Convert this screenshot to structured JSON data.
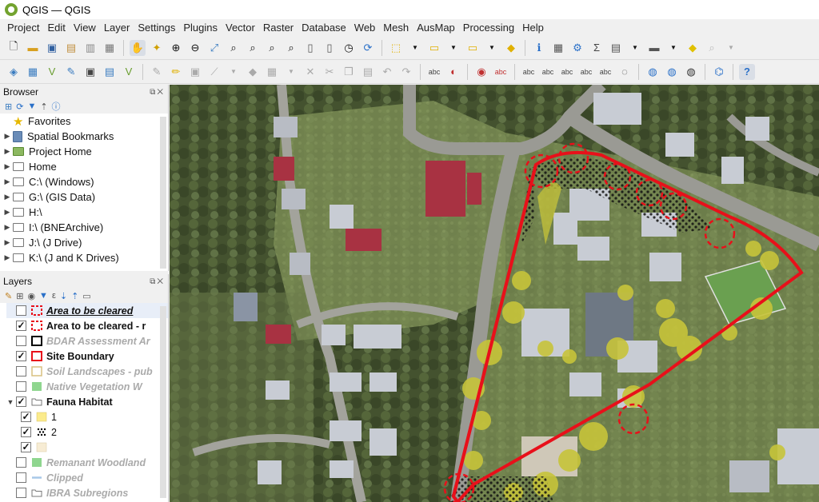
{
  "window": {
    "title": "QGIS — QGIS"
  },
  "menu": [
    "Project",
    "Edit",
    "View",
    "Layer",
    "Settings",
    "Plugins",
    "Vector",
    "Raster",
    "Database",
    "Web",
    "Mesh",
    "AusMap",
    "Processing",
    "Help"
  ],
  "browser": {
    "title": "Browser",
    "items": [
      {
        "label": "Favorites",
        "icon": "star-icon",
        "expand": false
      },
      {
        "label": "Spatial Bookmarks",
        "icon": "bookmark-icon",
        "expand": true
      },
      {
        "label": "Project Home",
        "icon": "project-home-icon",
        "expand": true
      },
      {
        "label": "Home",
        "icon": "home-icon",
        "expand": true
      },
      {
        "label": "C:\\ (Windows)",
        "icon": "folder-icon",
        "expand": true
      },
      {
        "label": "G:\\ (GIS Data)",
        "icon": "folder-icon",
        "expand": true
      },
      {
        "label": "H:\\",
        "icon": "folder-icon",
        "expand": true
      },
      {
        "label": "I:\\ (BNEArchive)",
        "icon": "folder-icon",
        "expand": true
      },
      {
        "label": "J:\\ (J Drive)",
        "icon": "folder-icon",
        "expand": true
      },
      {
        "label": "K:\\ (J and K Drives)",
        "icon": "folder-icon",
        "expand": true
      }
    ]
  },
  "layers": {
    "title": "Layers",
    "items": [
      {
        "label": "Area to be cleared",
        "checked": false,
        "style": "bold-italic-underline",
        "symbol": "dash-red",
        "indent": 0,
        "selected": true
      },
      {
        "label": "Area to be cleared - r",
        "checked": true,
        "style": "bold",
        "symbol": "dash-red",
        "indent": 0
      },
      {
        "label": "BDAR Assessment Ar",
        "checked": false,
        "style": "italic-grey",
        "symbol": "black-outline",
        "indent": 0
      },
      {
        "label": "Site Boundary",
        "checked": true,
        "style": "bold",
        "symbol": "red-outline",
        "indent": 0
      },
      {
        "label": "Soil Landscapes - pub",
        "checked": false,
        "style": "italic-grey",
        "symbol": "tan-outline",
        "indent": 0
      },
      {
        "label": "Native Vegetation W",
        "checked": false,
        "style": "italic-grey",
        "symbol": "green-fill",
        "indent": 0
      },
      {
        "label": "Fauna Habitat",
        "checked": true,
        "style": "bold",
        "symbol": "group",
        "indent": 0,
        "expand": true
      },
      {
        "label": "1",
        "checked": true,
        "style": "normal",
        "symbol": "yellow-fill",
        "indent": 1
      },
      {
        "label": "2",
        "checked": true,
        "style": "normal",
        "symbol": "dots",
        "indent": 1
      },
      {
        "label": "",
        "checked": true,
        "style": "normal",
        "symbol": "beige-fill",
        "indent": 1
      },
      {
        "label": "Remanant Woodland",
        "checked": false,
        "style": "italic-grey",
        "symbol": "green-fill",
        "indent": 0
      },
      {
        "label": "Clipped",
        "checked": false,
        "style": "italic-grey",
        "symbol": "blue-line",
        "indent": 0
      },
      {
        "label": "IBRA Subregions",
        "checked": false,
        "style": "italic-grey",
        "symbol": "group",
        "indent": 0
      }
    ]
  },
  "colors": {
    "site_boundary": "#e8101a",
    "area_cleared": "#e8101a",
    "fauna_habitat_1": "#f0e070",
    "accent": "#73a32f"
  }
}
